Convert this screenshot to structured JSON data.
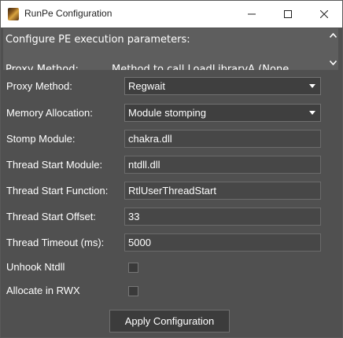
{
  "window": {
    "title": "RunPe Configuration",
    "controls": {
      "minimize": "minimize-icon",
      "maximize": "maximize-icon",
      "close": "close-icon"
    }
  },
  "description": {
    "line1": "Configure PE execution parameters:",
    "line2_key": "Proxy Method:",
    "line2_value": "Method to call LoadLibraryA (None"
  },
  "form": {
    "proxy_method": {
      "label": "Proxy Method:",
      "value": "Regwait"
    },
    "memory_allocation": {
      "label": "Memory Allocation:",
      "value": "Module stomping"
    },
    "stomp_module": {
      "label": "Stomp Module:",
      "value": "chakra.dll"
    },
    "thread_start_module": {
      "label": "Thread Start Module:",
      "value": "ntdll.dll"
    },
    "thread_start_function": {
      "label": "Thread Start Function:",
      "value": "RtlUserThreadStart"
    },
    "thread_start_offset": {
      "label": "Thread Start Offset:",
      "value": "33"
    },
    "thread_timeout": {
      "label": "Thread Timeout (ms):",
      "value": "5000"
    },
    "unhook_ntdll": {
      "label": "Unhook Ntdll",
      "checked": false
    },
    "allocate_rwx": {
      "label": "Allocate in RWX",
      "checked": false
    }
  },
  "apply_label": "Apply Configuration"
}
